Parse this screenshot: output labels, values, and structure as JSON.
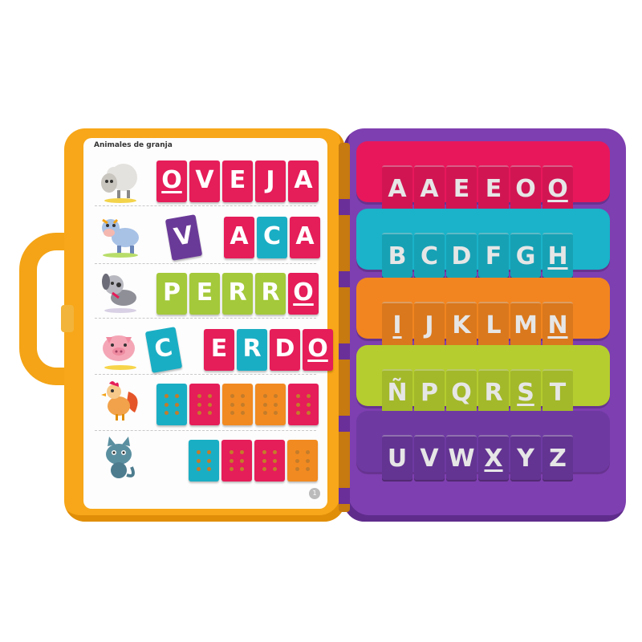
{
  "page": {
    "title": "Animales de granja",
    "number": "1"
  },
  "words": [
    {
      "animal": "sheep-icon",
      "tiles": [
        {
          "t": "O",
          "c": "#e51d59",
          "ul": true
        },
        {
          "t": "V",
          "c": "#e51d59"
        },
        {
          "t": "E",
          "c": "#e51d59"
        },
        {
          "t": "J",
          "c": "#e51d59"
        },
        {
          "t": "A",
          "c": "#e51d59"
        }
      ]
    },
    {
      "animal": "cow-icon",
      "tiles": [
        {
          "t": "V",
          "c": "#6a3a98",
          "tilt": true
        },
        {
          "t": "A",
          "c": "#e51d59"
        },
        {
          "t": "C",
          "c": "#1aaec4"
        },
        {
          "t": "A",
          "c": "#e51d59"
        }
      ]
    },
    {
      "animal": "dog-icon",
      "tiles": [
        {
          "t": "P",
          "c": "#a4c93a"
        },
        {
          "t": "E",
          "c": "#a4c93a"
        },
        {
          "t": "R",
          "c": "#a4c93a"
        },
        {
          "t": "R",
          "c": "#a4c93a"
        },
        {
          "t": "O",
          "c": "#e51d59",
          "ul": true
        }
      ]
    },
    {
      "animal": "pig-icon",
      "tiles": [
        {
          "t": "C",
          "c": "#1aaec4",
          "tilt": true
        },
        {
          "t": "E",
          "c": "#e51d59"
        },
        {
          "t": "R",
          "c": "#1aaec4"
        },
        {
          "t": "D",
          "c": "#e51d59"
        },
        {
          "t": "O",
          "c": "#e51d59",
          "ul": true
        }
      ]
    },
    {
      "animal": "rooster-icon",
      "tiles": [
        {
          "t": "",
          "c": "#1aaec4"
        },
        {
          "t": "",
          "c": "#e51d59"
        },
        {
          "t": "",
          "c": "#f18a21"
        },
        {
          "t": "",
          "c": "#f18a21"
        },
        {
          "t": "",
          "c": "#e51d59"
        }
      ]
    },
    {
      "animal": "cat-icon",
      "tiles": [
        {
          "t": "",
          "c": "#1aaec4"
        },
        {
          "t": "",
          "c": "#e51d59"
        },
        {
          "t": "",
          "c": "#e51d59"
        },
        {
          "t": "",
          "c": "#f18a21"
        }
      ]
    }
  ],
  "alphabet": [
    {
      "color": "#e8175c",
      "letters": [
        {
          "t": "A"
        },
        {
          "t": "A"
        },
        {
          "t": "E"
        },
        {
          "t": "E"
        },
        {
          "t": "O"
        },
        {
          "t": "O",
          "ul": true
        }
      ]
    },
    {
      "color": "#1ab3c9",
      "letters": [
        {
          "t": "B"
        },
        {
          "t": "C"
        },
        {
          "t": "D"
        },
        {
          "t": "F"
        },
        {
          "t": "G"
        },
        {
          "t": "H",
          "ul": true
        }
      ]
    },
    {
      "color": "#f28520",
      "letters": [
        {
          "t": "I",
          "ul": true
        },
        {
          "t": "J"
        },
        {
          "t": "K"
        },
        {
          "t": "L"
        },
        {
          "t": "M"
        },
        {
          "t": "N",
          "ul": true
        }
      ]
    },
    {
      "color": "#b5cd2f",
      "letters": [
        {
          "t": "Ñ"
        },
        {
          "t": "P"
        },
        {
          "t": "Q"
        },
        {
          "t": "R"
        },
        {
          "t": "S",
          "ul": true
        },
        {
          "t": "T"
        }
      ]
    },
    {
      "color": "#6e3aa2",
      "letters": [
        {
          "t": "U"
        },
        {
          "t": "V"
        },
        {
          "t": "W"
        },
        {
          "t": "X",
          "ul": true
        },
        {
          "t": "Y"
        },
        {
          "t": "Z"
        }
      ]
    }
  ],
  "colors": {
    "case_left": "#f7a719",
    "case_right": "#7e3fb0"
  }
}
